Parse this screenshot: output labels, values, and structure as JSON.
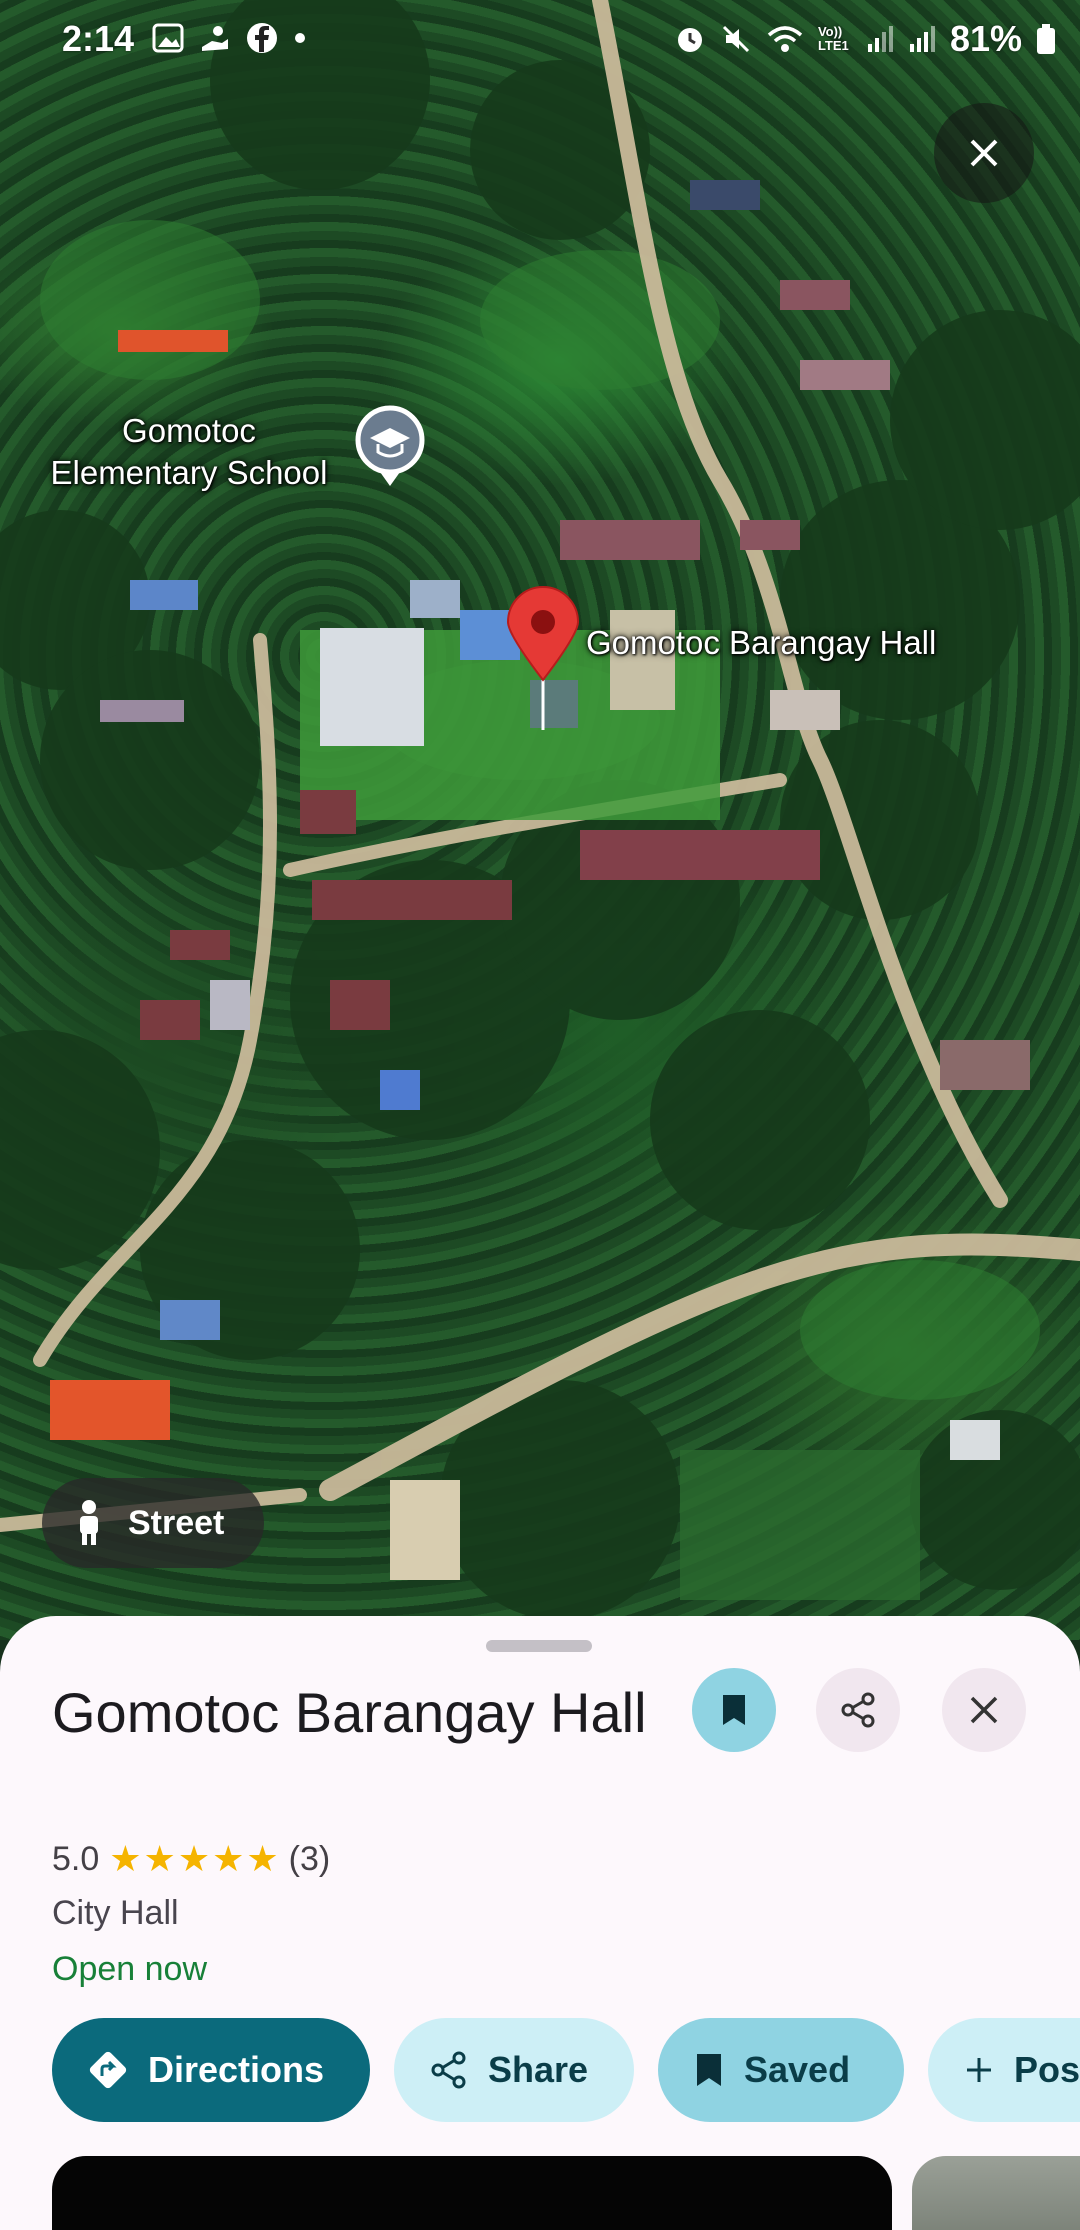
{
  "status_bar": {
    "time": "2:14",
    "battery": "81%",
    "left_icons": [
      "gallery-icon",
      "hand-icon",
      "facebook-icon",
      "dot-icon"
    ],
    "right_icons": [
      "alarm-icon",
      "mute-icon",
      "wifi-icon",
      "volte-icon",
      "signal-icon",
      "signal-icon",
      "battery-icon"
    ],
    "volte_label": "Vo)) LTE1"
  },
  "map": {
    "labels": {
      "school": "Gomotoc\nElementary School",
      "barangay_hall": "Gomotoc Barangay Hall"
    },
    "street_button": "Street"
  },
  "place": {
    "name": "Gomotoc Barangay Hall",
    "rating": "5.0",
    "stars": 5,
    "review_count": "(3)",
    "category": "City Hall",
    "open_status": "Open now"
  },
  "actions": {
    "directions": "Directions",
    "share": "Share",
    "saved": "Saved",
    "post": "Pos"
  },
  "colors": {
    "primary": "#0b6a7c",
    "chip_light": "#cdeff6",
    "chip_saved": "#8fd3e2",
    "open_green": "#188038",
    "star": "#f5b400",
    "pin_red": "#e53935"
  }
}
